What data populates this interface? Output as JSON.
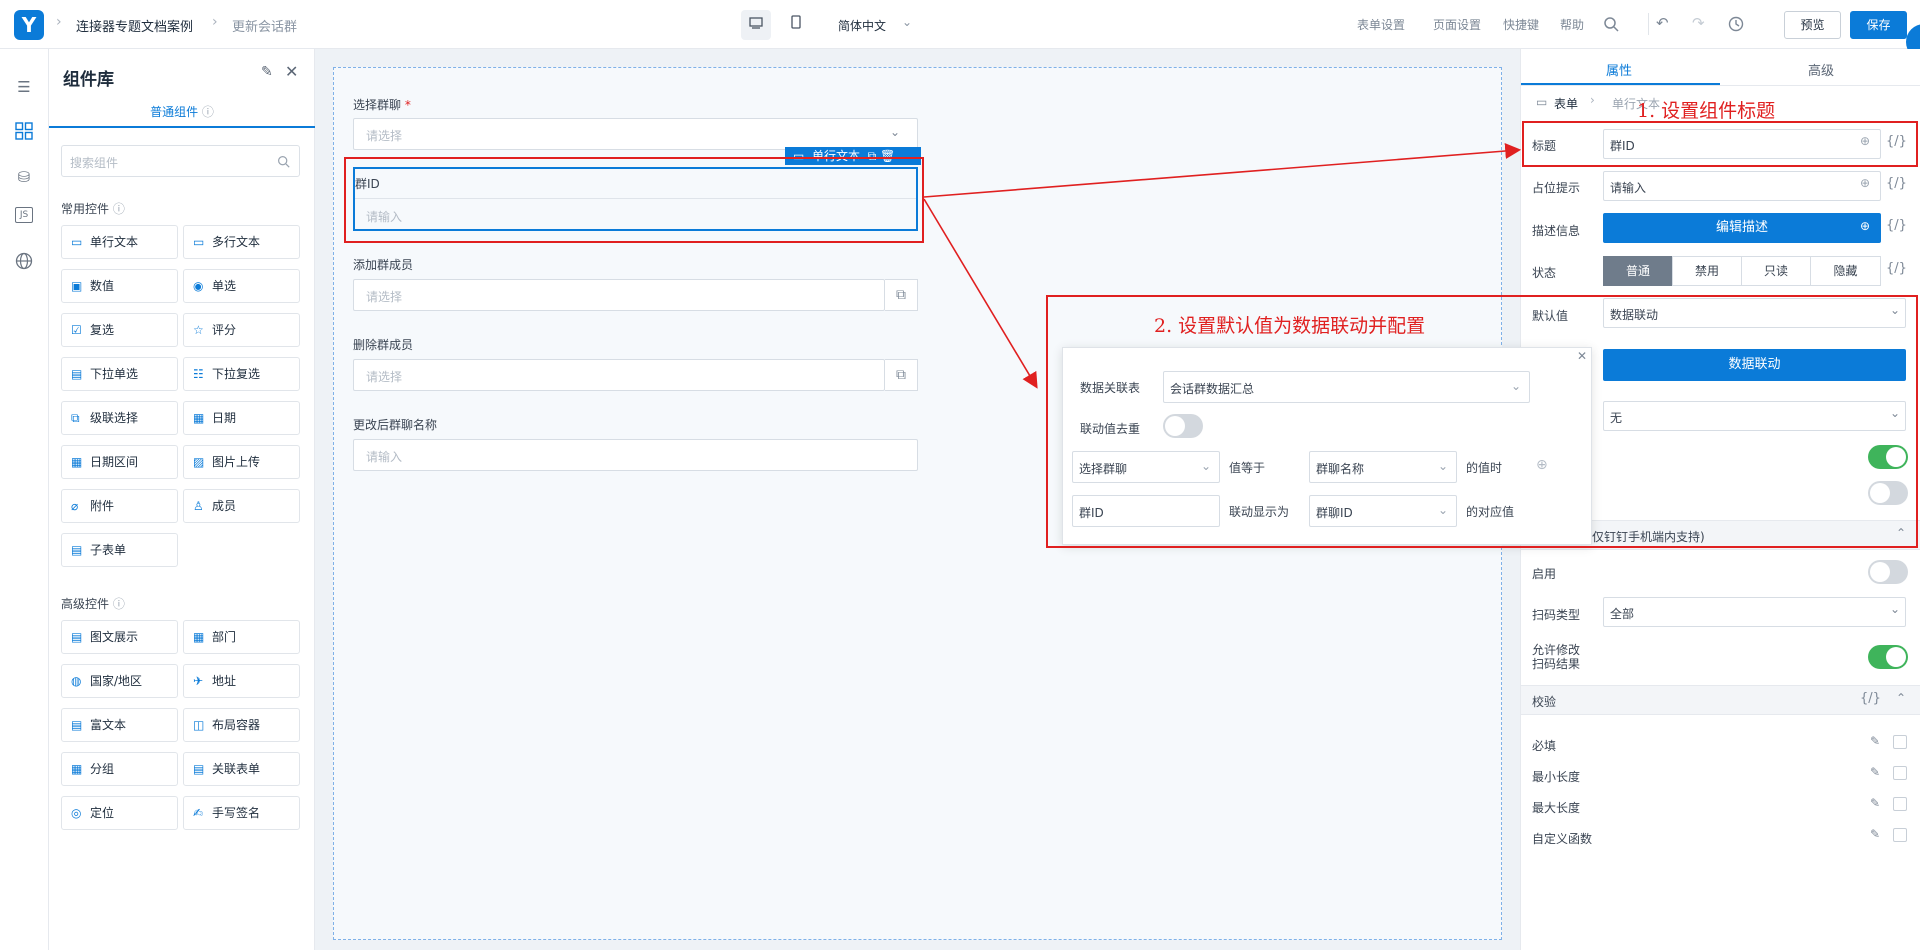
{
  "topbar": {
    "breadcrumb": [
      "连接器专题文档案例",
      "更新会话群"
    ],
    "language": "简体中文",
    "links": [
      "表单设置",
      "页面设置",
      "快捷键",
      "帮助"
    ],
    "preview_label": "预览",
    "save_label": "保存"
  },
  "library": {
    "title": "组件库",
    "tab": "普通组件",
    "search_placeholder": "搜索组件",
    "common_title": "常用控件",
    "common": [
      "单行文本",
      "多行文本",
      "数值",
      "单选",
      "复选",
      "评分",
      "下拉单选",
      "下拉复选",
      "级联选择",
      "日期",
      "日期区间",
      "图片上传",
      "附件",
      "成员",
      "子表单"
    ],
    "advanced_title": "高级控件",
    "advanced": [
      "图文展示",
      "部门",
      "国家/地区",
      "地址",
      "富文本",
      "布局容器",
      "分组",
      "关联表单",
      "定位",
      "手写签名"
    ]
  },
  "form": {
    "field1_label": "选择群聊",
    "required_mark": "*",
    "field1_placeholder": "请选择",
    "field2_label": "群ID",
    "field2_placeholder": "请输入",
    "field2_tag": "单行文本",
    "field3_label": "添加群成员",
    "field3_placeholder": "请选择",
    "field4_label": "删除群成员",
    "field4_placeholder": "请选择",
    "field5_label": "更改后群聊名称",
    "field5_placeholder": "请输入"
  },
  "right": {
    "tab_props": "属性",
    "tab_advanced": "高级",
    "crumb": [
      "表单",
      "单行文本"
    ],
    "title_label": "标题",
    "title_value": "群ID",
    "placeholder_label": "占位提示",
    "placeholder_value": "请输入",
    "desc_label": "描述信息",
    "desc_button": "编辑描述",
    "state_label": "状态",
    "states": [
      "普通",
      "禁用",
      "只读",
      "隐藏"
    ],
    "default_label": "默认值",
    "default_value": "数据联动",
    "link_button": "数据联动",
    "none_value": "无",
    "scan_section": "仅钉钉手机端内支持)",
    "enable_label": "启用",
    "scan_type_label": "扫码类型",
    "scan_type_value": "全部",
    "allow_modify_label_1": "允许修改",
    "allow_modify_label_2": "扫码结果",
    "validate_title": "校验",
    "rules": [
      "必填",
      "最小长度",
      "最大长度",
      "自定义函数"
    ],
    "curly": "{/}"
  },
  "popup": {
    "table_label": "数据关联表",
    "table_value": "会话群数据汇总",
    "dedupe_label": "联动值去重",
    "cond_left": "选择群聊",
    "cond_eq": "值等于",
    "cond_right": "群聊名称",
    "cond_when": "的值时",
    "show_left": "群ID",
    "show_as": "联动显示为",
    "show_right": "群聊ID",
    "show_value": "的对应值"
  },
  "annotations": {
    "step1": "1. 设置组件标题",
    "step2": "2. 设置默认值为数据联动并配置"
  },
  "colors": {
    "brand": "#0b7bd8",
    "annotation": "#e02020",
    "toggle_on": "#3fb45b"
  }
}
